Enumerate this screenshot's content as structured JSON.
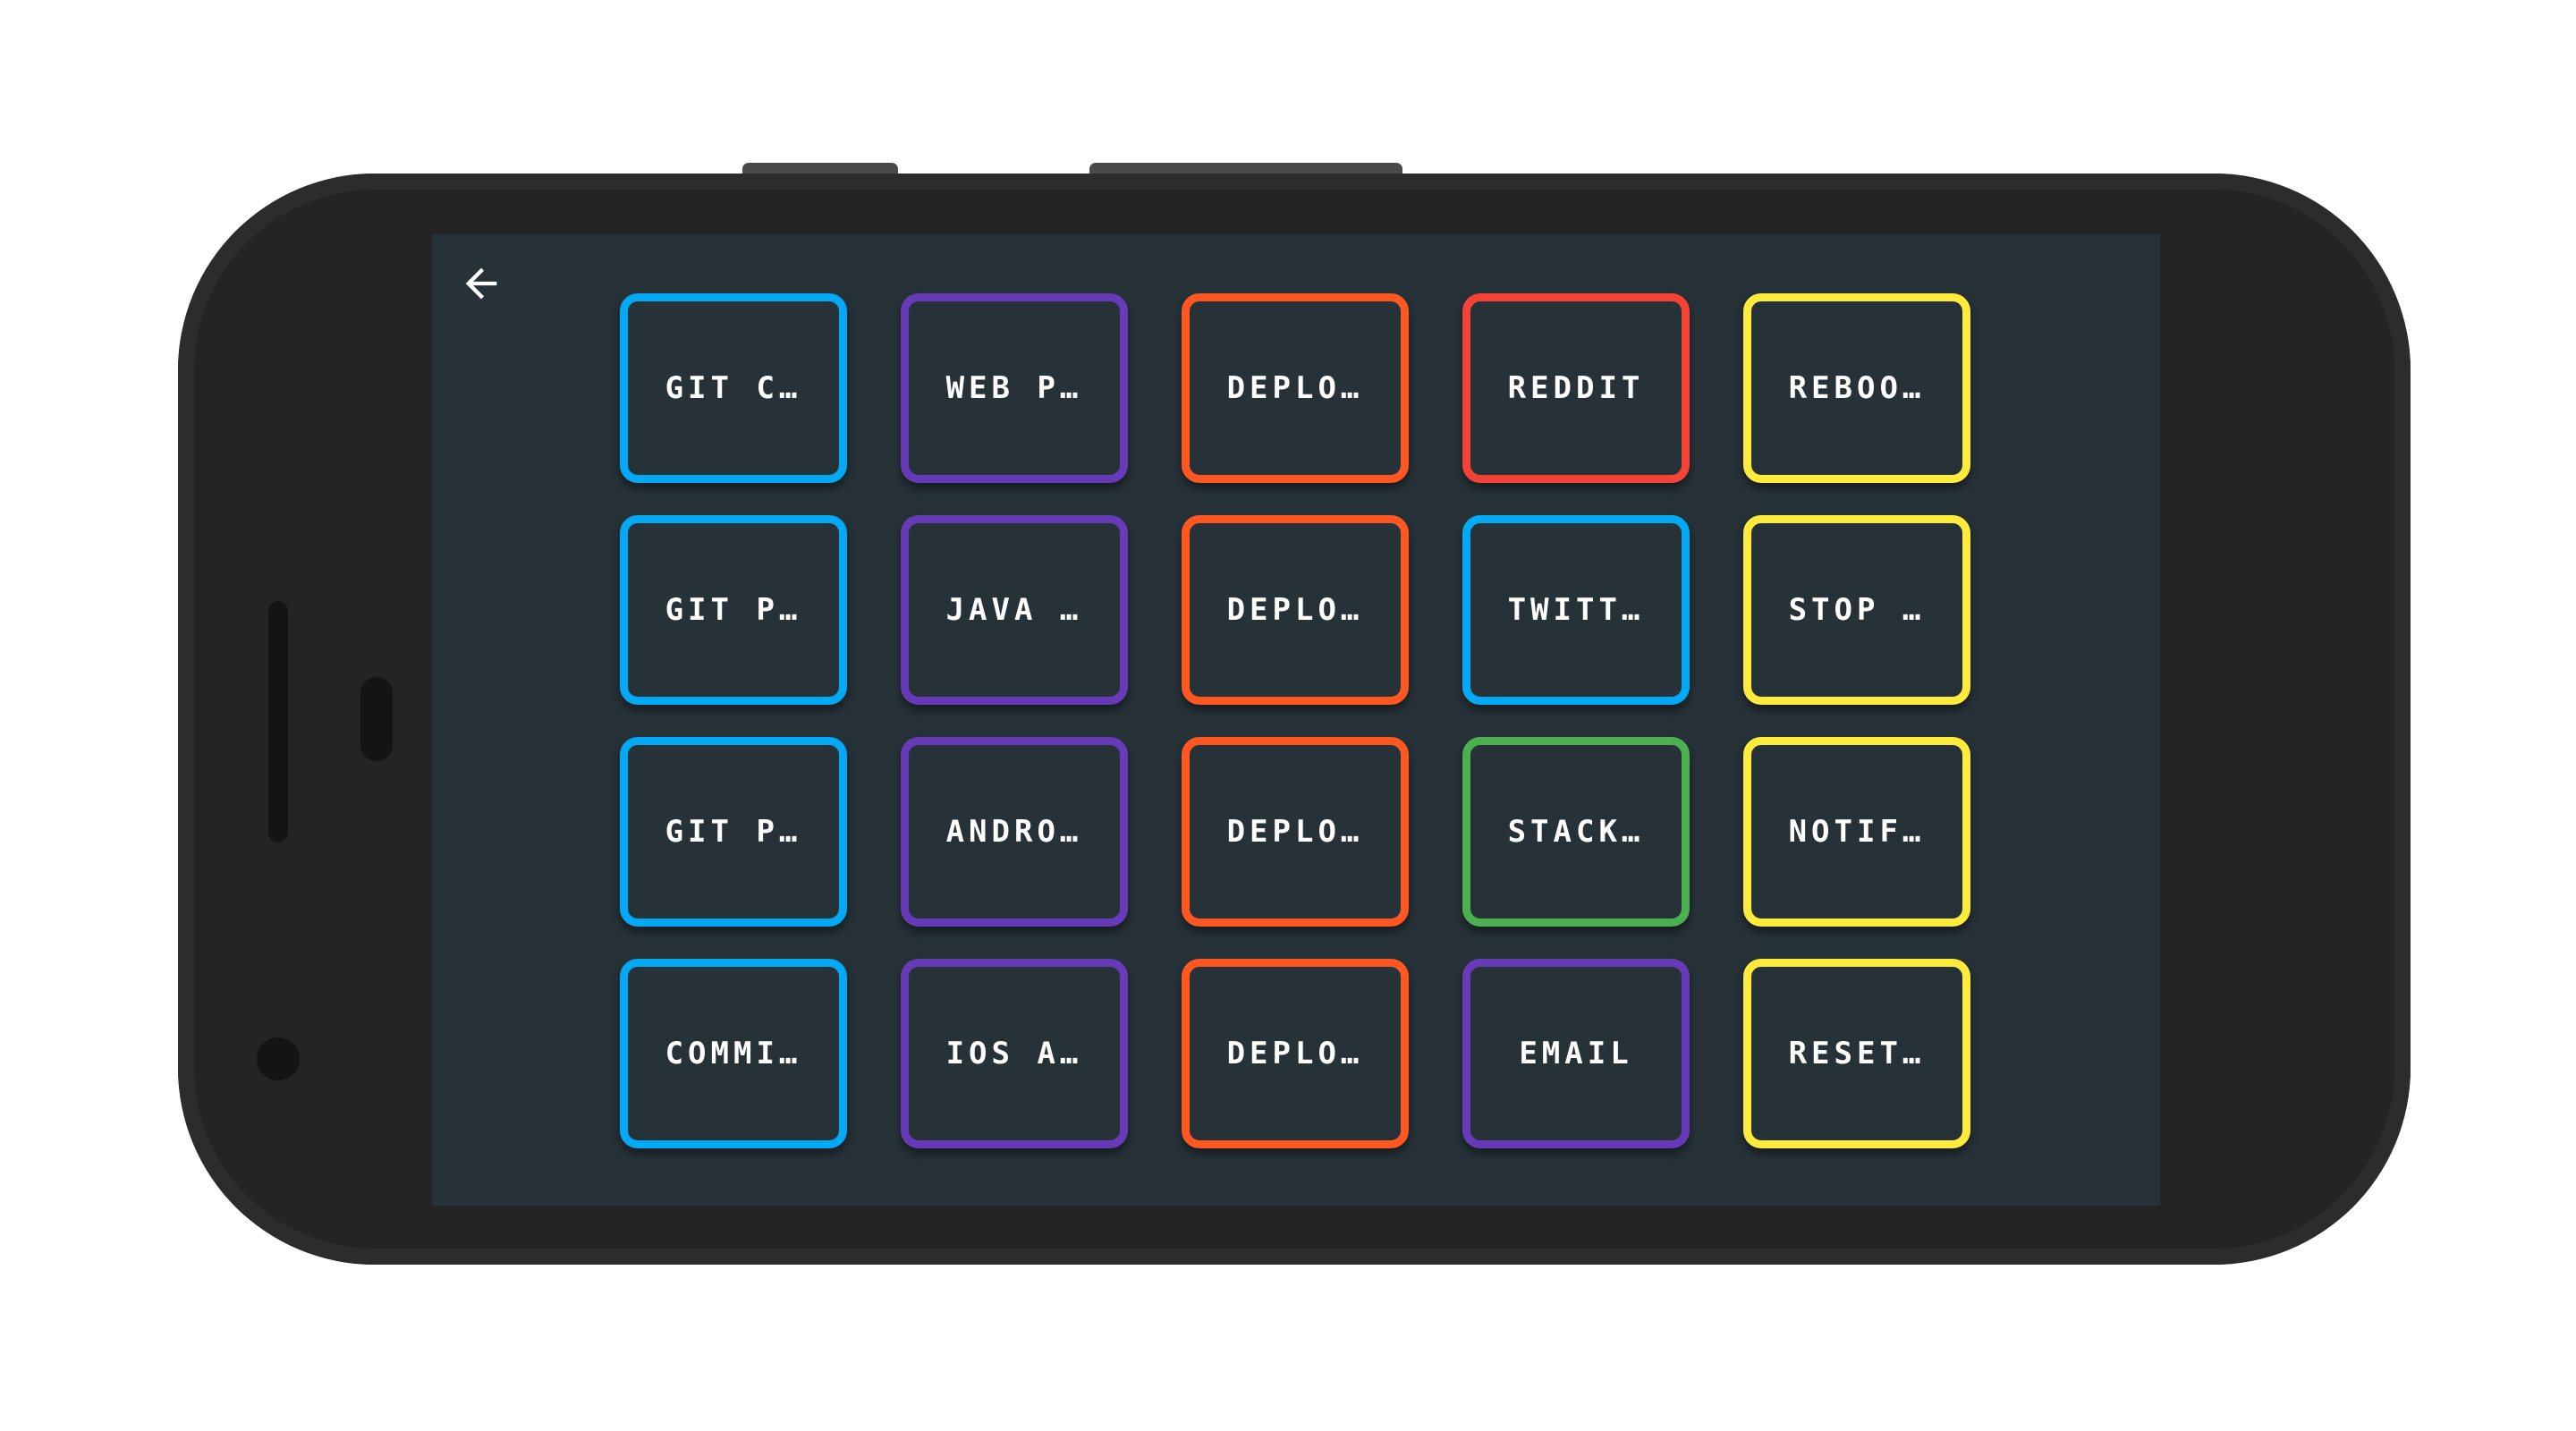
{
  "tiles": [
    {
      "label": "GIT C…",
      "color": "#03a9f4"
    },
    {
      "label": "WEB P…",
      "color": "#673ab7"
    },
    {
      "label": "DEPLO…",
      "color": "#ff5722"
    },
    {
      "label": "REDDIT",
      "color": "#f44336"
    },
    {
      "label": "REBOO…",
      "color": "#ffeb3b"
    },
    {
      "label": "GIT P…",
      "color": "#03a9f4"
    },
    {
      "label": "JAVA …",
      "color": "#673ab7"
    },
    {
      "label": "DEPLO…",
      "color": "#ff5722"
    },
    {
      "label": "TWITT…",
      "color": "#03a9f4"
    },
    {
      "label": "STOP …",
      "color": "#ffeb3b"
    },
    {
      "label": "GIT P…",
      "color": "#03a9f4"
    },
    {
      "label": "ANDRO…",
      "color": "#673ab7"
    },
    {
      "label": "DEPLO…",
      "color": "#ff5722"
    },
    {
      "label": "STACK…",
      "color": "#4caf50"
    },
    {
      "label": "NOTIF…",
      "color": "#ffeb3b"
    },
    {
      "label": "COMMI…",
      "color": "#03a9f4"
    },
    {
      "label": "IOS A…",
      "color": "#673ab7"
    },
    {
      "label": "DEPLO…",
      "color": "#ff5722"
    },
    {
      "label": "EMAIL",
      "color": "#673ab7"
    },
    {
      "label": "RESET…",
      "color": "#ffeb3b"
    }
  ],
  "icons": {
    "back": "arrow-left-icon"
  },
  "colors": {
    "screen_background": "#263238",
    "device_body": "#242424",
    "label_text": "#ffffff"
  }
}
